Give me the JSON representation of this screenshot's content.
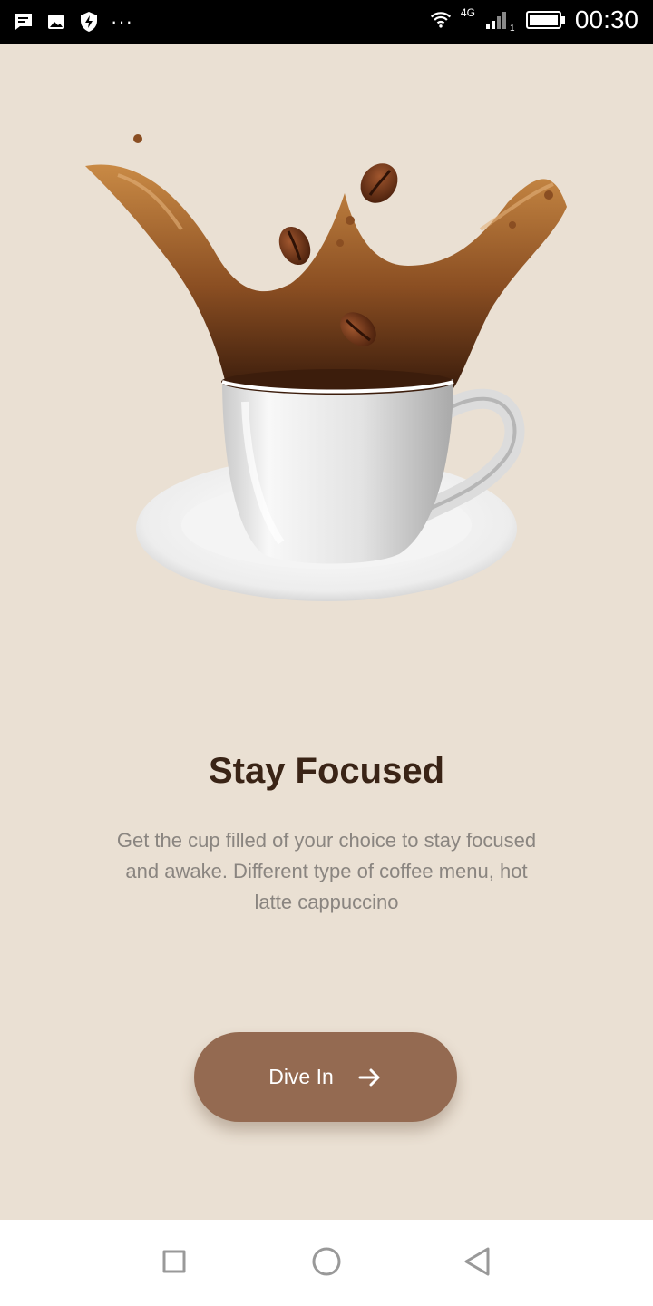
{
  "status_bar": {
    "time": "00:30",
    "network": "4G",
    "sim_slot": "1",
    "overflow": "···",
    "icons": [
      "message-icon",
      "image-icon",
      "shield-icon",
      "wifi-icon",
      "signal-icon",
      "battery-icon"
    ]
  },
  "onboarding": {
    "title": "Stay Focused",
    "description": "Get the cup filled of your choice to stay focused and awake. Different type of coffee menu, hot latte cappuccino",
    "cta_label": "Dive In"
  },
  "nav_bar": {
    "icons": [
      "recent-apps-icon",
      "home-icon",
      "back-icon"
    ]
  },
  "colors": {
    "background": "#EAE0D3",
    "title": "#3A2416",
    "description": "#8A8580",
    "button": "#946A51",
    "button_text": "#FFFFFF"
  }
}
